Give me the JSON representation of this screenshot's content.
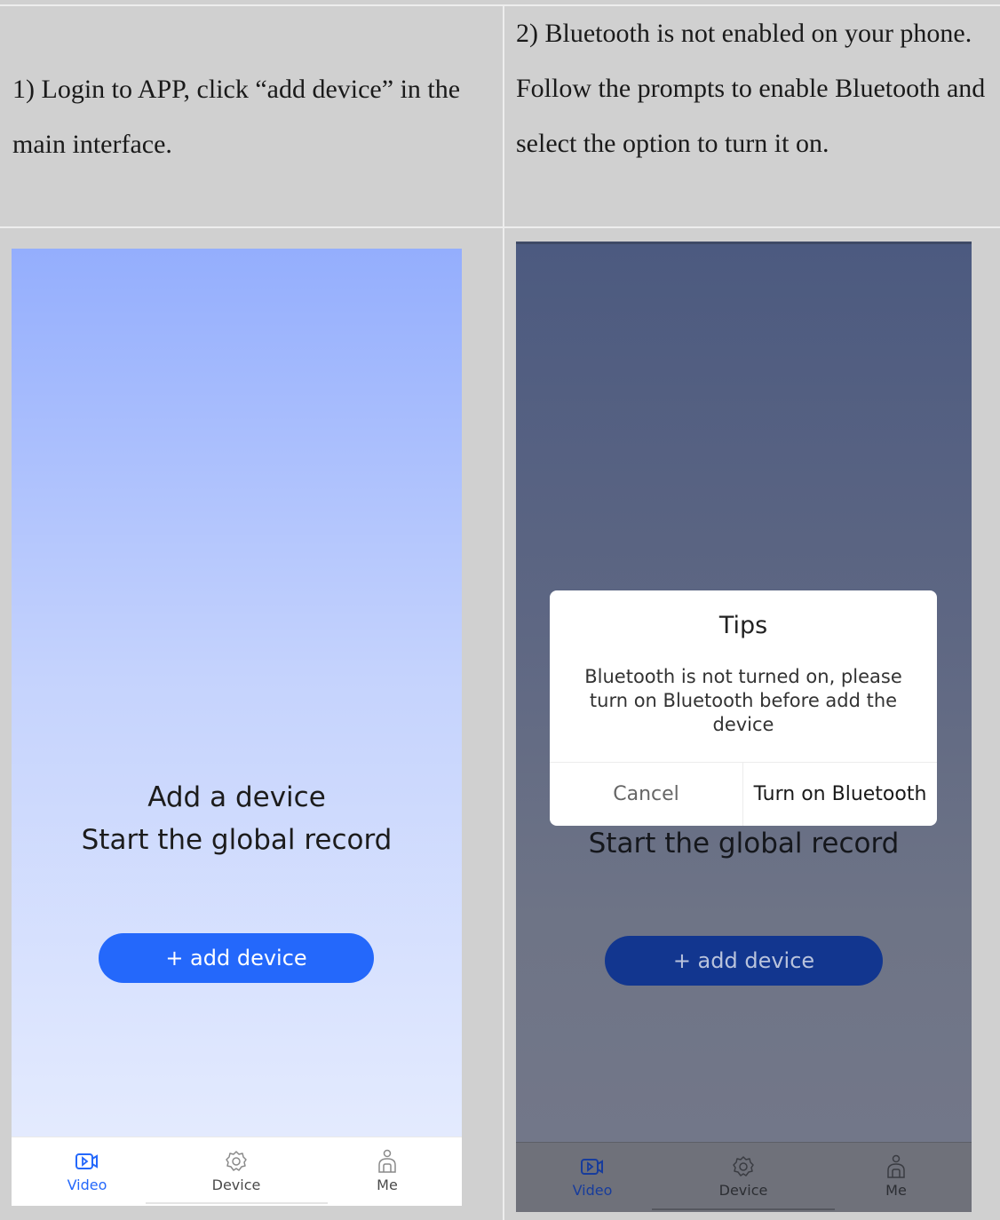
{
  "instructions": {
    "step1": "1) Login to APP, click “add device” in the main interface.",
    "step2": "2) Bluetooth is not enabled on your phone. Follow the prompts to enable Bluetooth and select the option to turn it on."
  },
  "screen_left": {
    "hero_line1": "Add a device",
    "hero_line2": "Start the global record",
    "add_button": "+ add device",
    "tabs": [
      {
        "label": "Video",
        "icon": "video-icon",
        "active": true
      },
      {
        "label": "Device",
        "icon": "gear-icon",
        "active": false
      },
      {
        "label": "Me",
        "icon": "person-icon",
        "active": false
      }
    ]
  },
  "screen_right": {
    "hero_line2": "Start the global record",
    "add_button": "+ add device",
    "dialog": {
      "title": "Tips",
      "message": "Bluetooth is not turned on, please turn on Bluetooth before add the device",
      "cancel": "Cancel",
      "confirm": "Turn on Bluetooth"
    },
    "tabs": [
      {
        "label": "Video",
        "icon": "video-icon",
        "active": true
      },
      {
        "label": "Device",
        "icon": "gear-icon",
        "active": false
      },
      {
        "label": "Me",
        "icon": "person-icon",
        "active": false
      }
    ]
  },
  "colors": {
    "accent": "#2468fb",
    "dim_accent": "#12368f"
  }
}
